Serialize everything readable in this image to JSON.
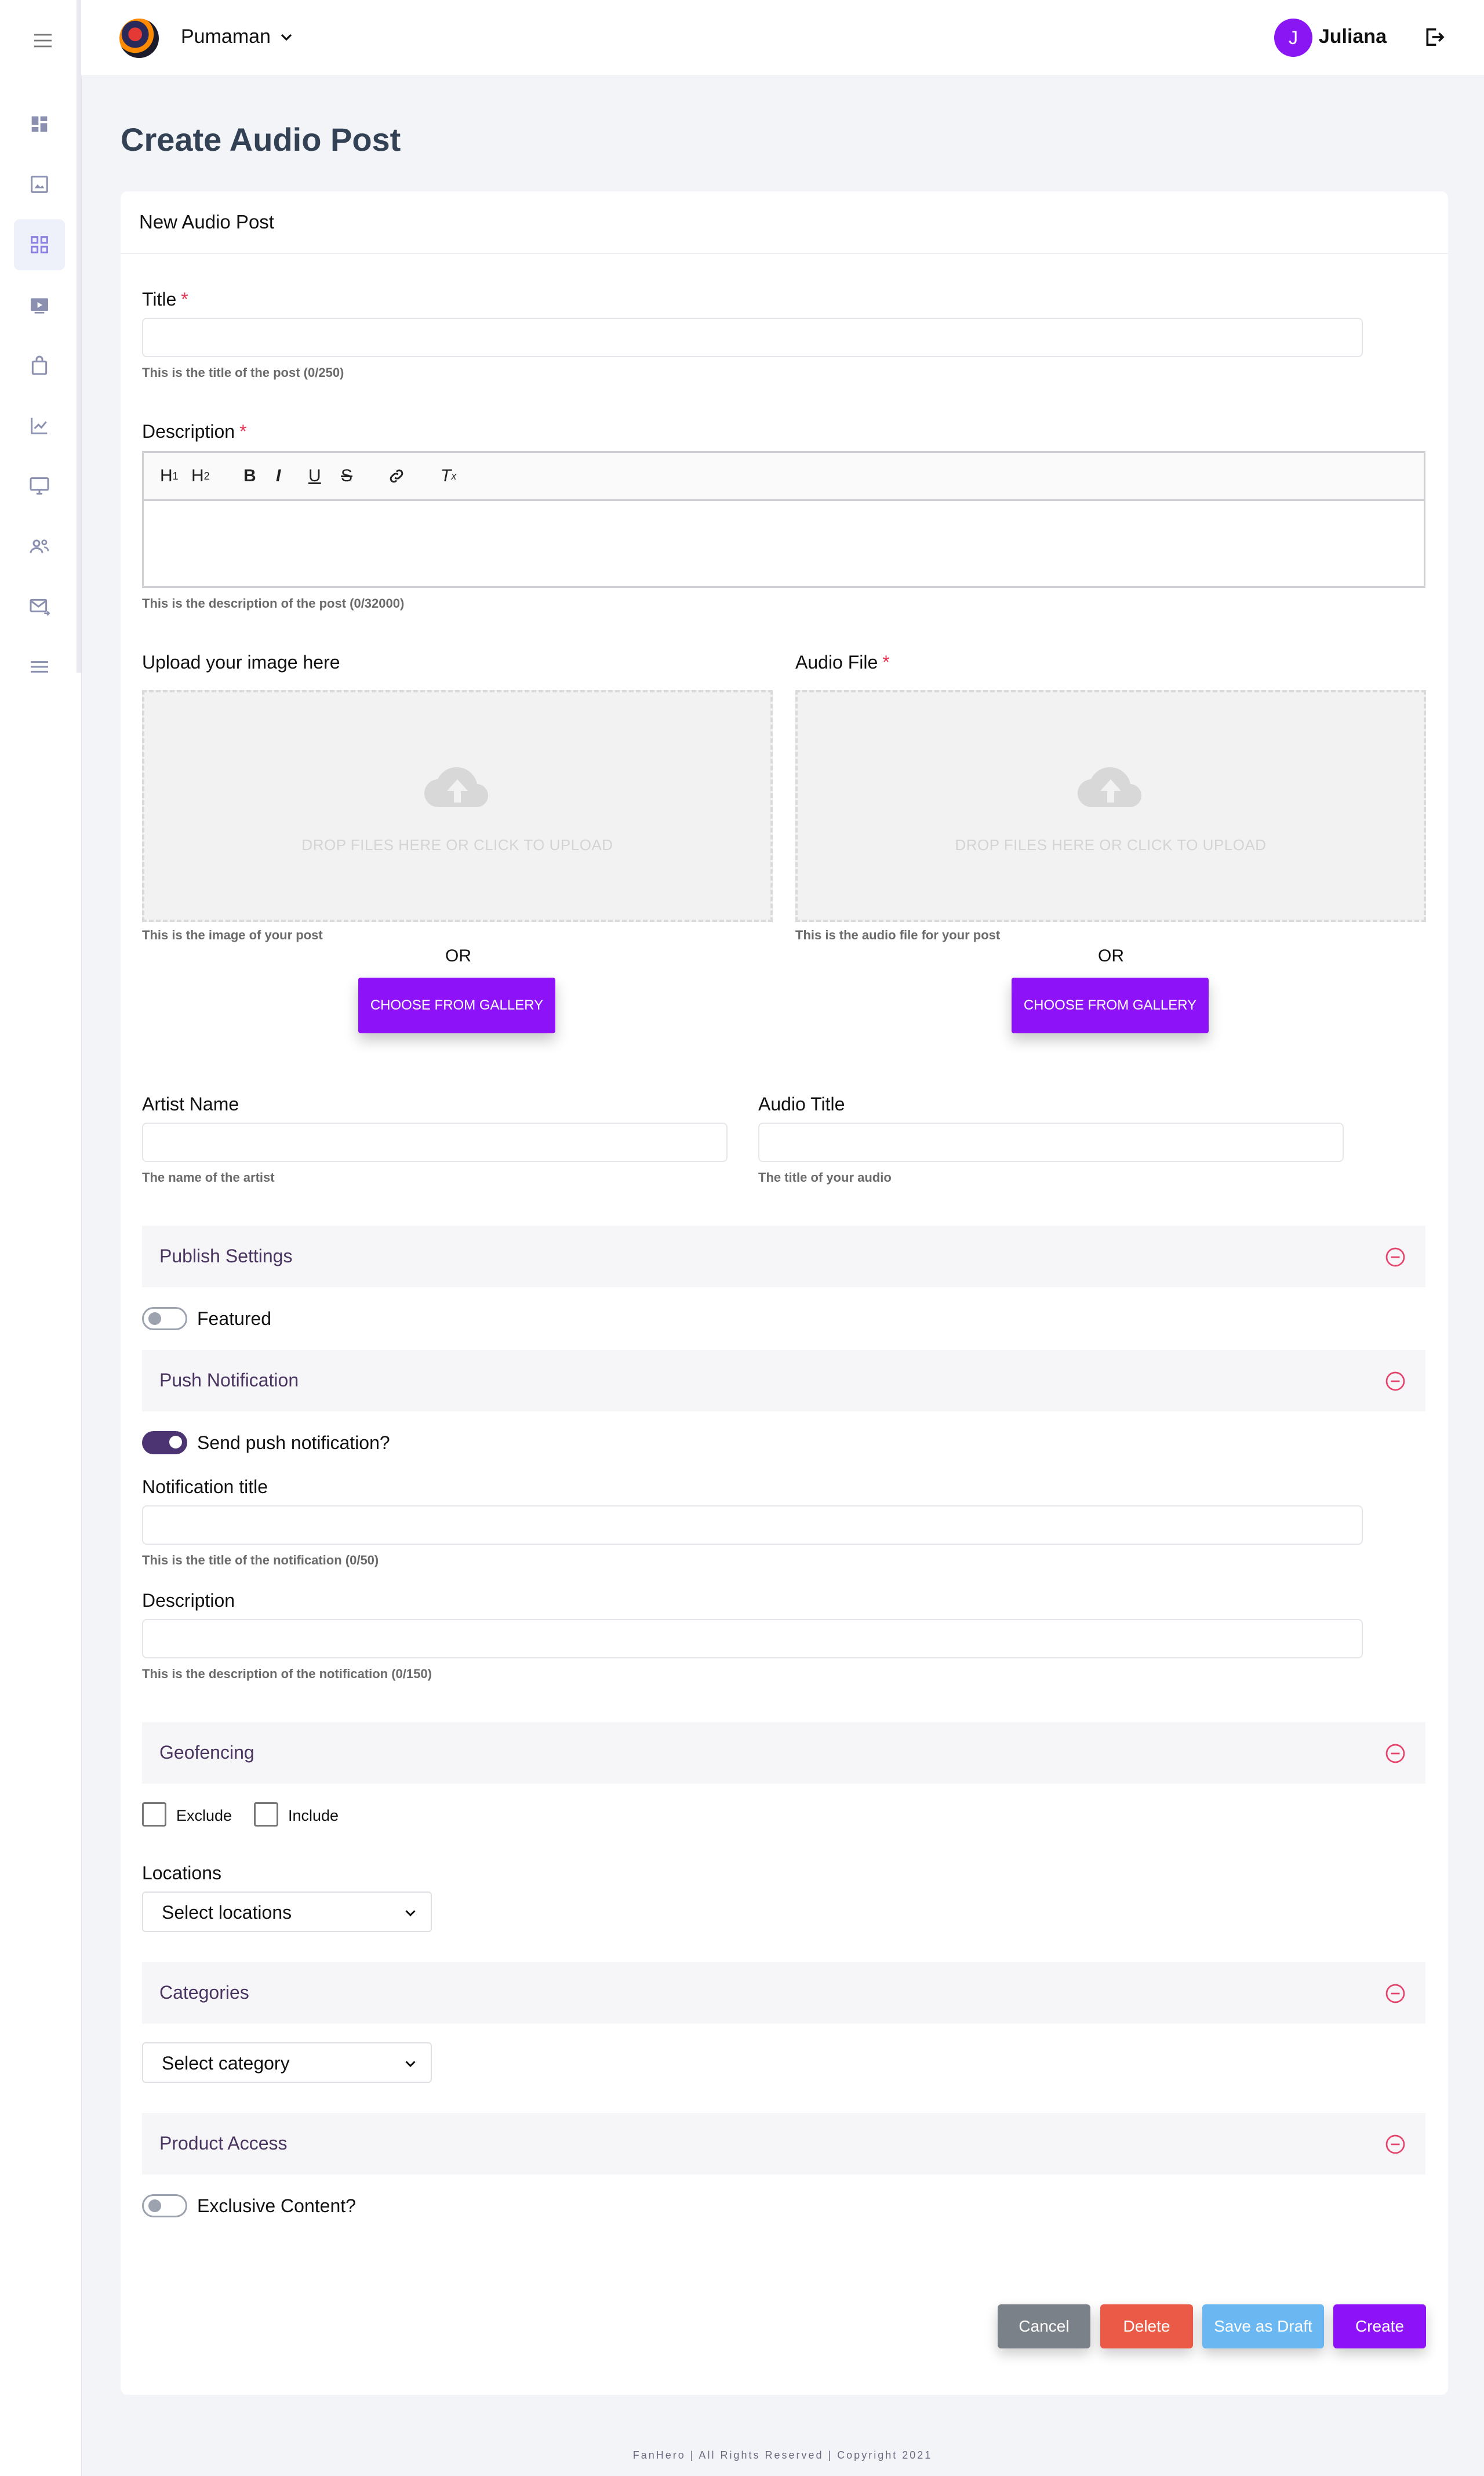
{
  "topbar": {
    "org_name": "Pumaman",
    "user_initial": "J",
    "user_name": "Juliana"
  },
  "page_title": "Create Audio Post",
  "card_title": "New Audio Post",
  "fields": {
    "title_label": "Title",
    "title_help": "This is the title of the post (0/250)",
    "description_label": "Description",
    "description_help": "This is the description of the post (0/32000)",
    "image_label": "Upload your image here",
    "image_help": "This is the image of your post",
    "audio_label": "Audio File",
    "audio_help": "This is the audio file for your post",
    "dropzone_text": "DROP FILES HERE OR CLICK TO UPLOAD",
    "or_text": "OR",
    "gallery_button": "CHOOSE FROM GALLERY",
    "artist_label": "Artist Name",
    "artist_help": "The name of the artist",
    "audio_title_label": "Audio Title",
    "audio_title_help": "The title of your audio",
    "required_mark": "*"
  },
  "editor_toolbar": [
    "H1",
    "H2",
    "B",
    "I",
    "U",
    "S",
    "link",
    "Tx"
  ],
  "sections": {
    "publish": "Publish Settings",
    "featured": "Featured",
    "push": "Push Notification",
    "send_push": "Send push notification?",
    "notif_title_label": "Notification title",
    "notif_title_help": "This is the title of the notification (0/50)",
    "notif_desc_label": "Description",
    "notif_desc_help": "This is the description of the notification (0/150)",
    "geofencing": "Geofencing",
    "exclude": "Exclude",
    "include": "Include",
    "locations_label": "Locations",
    "locations_placeholder": "Select locations",
    "categories": "Categories",
    "category_placeholder": "Select category",
    "product_access": "Product Access",
    "exclusive": "Exclusive Content?"
  },
  "toggles": {
    "featured": false,
    "send_push": true,
    "exclusive": false
  },
  "actions": {
    "cancel": "Cancel",
    "delete": "Delete",
    "draft": "Save as Draft",
    "create": "Create"
  },
  "colors": {
    "primary": "#8d12f7",
    "cancel": "#7b8188",
    "delete": "#ea5a47",
    "draft": "#6ab7f2",
    "accent_text": "#4a3560"
  },
  "footer": "FanHero | All Rights Reserved | Copyright 2021"
}
